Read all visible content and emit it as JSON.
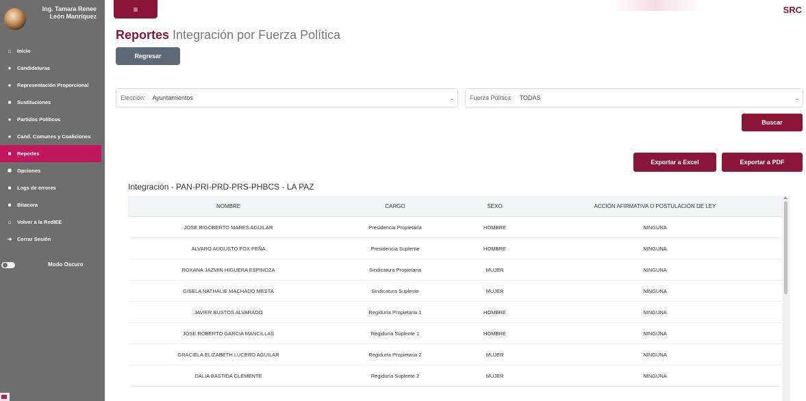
{
  "user": {
    "name_line1": "Ing. Tamara Renee",
    "name_line2": "León Manríquez"
  },
  "sidebar": {
    "items": [
      {
        "label": "Inicio",
        "icon": "home-icon",
        "active": false
      },
      {
        "label": "Candidaturas",
        "icon": "user-icon",
        "active": false
      },
      {
        "label": "Representación Proporcional",
        "icon": "user-icon",
        "active": false
      },
      {
        "label": "Sustituciones",
        "icon": "file-icon",
        "active": false
      },
      {
        "label": "Partidos Políticos",
        "icon": "users-icon",
        "active": false
      },
      {
        "label": "Cand. Comunes y Coaliciones",
        "icon": "users-icon",
        "active": false
      },
      {
        "label": "Reportes",
        "icon": "file-icon",
        "active": true
      },
      {
        "label": "Opciones",
        "icon": "gears-icon",
        "active": false
      },
      {
        "label": "Logs de errores",
        "icon": "file-icon",
        "active": false
      },
      {
        "label": "Bitacora",
        "icon": "file-icon",
        "active": false
      },
      {
        "label": "Volver a la RedIEE",
        "icon": "home-icon",
        "active": false
      },
      {
        "label": "Cerrar Sesión",
        "icon": "sign-out-icon",
        "active": false
      }
    ],
    "dark_mode_label": "Modo Oscuro"
  },
  "header": {
    "brand": "SRC",
    "menu_icon": "≡"
  },
  "page": {
    "title_strong": "Reportes",
    "title_rest": "Integración por Fuerza Política",
    "back_label": "Regresar"
  },
  "filters": {
    "eleccion_label": "Elección:",
    "eleccion_value": "Ayuntamientos",
    "fuerza_label": "Fuerza Política:",
    "fuerza_value": "TODAS"
  },
  "actions": {
    "buscar": "Buscar",
    "excel": "Exportar a Excel",
    "pdf": "Exportar a PDF"
  },
  "table": {
    "title": "Integración - PAN-PRI-PRD-PRS-PHBCS - LA PAZ",
    "headers": [
      "NOMBRE",
      "CARGO",
      "SEXO",
      "ACCIÓN AFIRMATIVA O POSTULACIÓN DE LEY"
    ],
    "rows": [
      [
        "JOSE RIGOBERTO MARES AGUILAR",
        "Presidencia Propietaria",
        "HOMBRE",
        "NINGUNA"
      ],
      [
        "ALVARO AUGUSTO FOX PEÑA",
        "Presidencia Suplente",
        "HOMBRE",
        "NINGUNA"
      ],
      [
        "ROXANA JAZMIN HIGUERA ESPINOZA",
        "Sindicatura Propietaria",
        "MUJER",
        "NINGUNA"
      ],
      [
        "GISELA NATHALIE MACHADO MESTA",
        "Sindicatura Suplente",
        "MUJER",
        "NINGUNA"
      ],
      [
        "JAVIER BUSTOS ALVARADO",
        "Regiduría Propietaria 1",
        "HOMBRE",
        "NINGUNA"
      ],
      [
        "JOSE ROBERTO GARCIA MANCILLAS",
        "Regiduría Suplente 1",
        "HOMBRE",
        "NINGUNA"
      ],
      [
        "GRACIELA ELIZABETH LUCERO AGUILAR",
        "Regiduría Propietaria 2",
        "MUJER",
        "NINGUNA"
      ],
      [
        "DALIA BASTIDA CLEMENTE",
        "Regiduría Suplente 2",
        "MUJER",
        "NINGUNA"
      ]
    ]
  },
  "colors": {
    "sidebar": "#6e6e6e",
    "accent": "#8b1538",
    "active": "#c2185b"
  }
}
